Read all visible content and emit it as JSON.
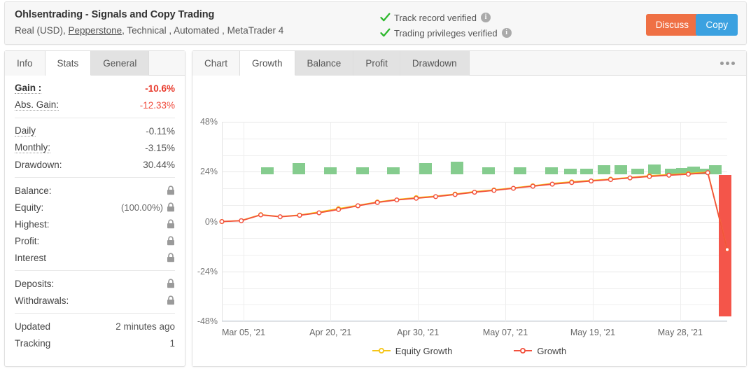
{
  "header": {
    "title": "Ohlsentrading - Signals and Copy Trading",
    "subtitle_parts": {
      "prefix": "Real (USD),",
      "broker": "Pepperstone",
      "suffix": ", Technical , Automated , MetaTrader 4"
    },
    "verifications": [
      {
        "label": "Track record verified",
        "icon": "check-icon",
        "info": "i"
      },
      {
        "label": "Trading privileges verified",
        "icon": "check-icon",
        "info": "i"
      }
    ],
    "buttons": {
      "discuss": "Discuss",
      "copy": "Copy"
    },
    "colors": {
      "discuss_bg": "#ef7044",
      "copy_bg": "#3ba1e0",
      "check_green": "#2eb82e",
      "info_grey": "#aaaaaa"
    }
  },
  "sidebar": {
    "tabs": [
      {
        "label": "Info",
        "active": false
      },
      {
        "label": "Stats",
        "active": true
      },
      {
        "label": "General",
        "active": false
      }
    ],
    "groups": [
      {
        "rows": [
          {
            "label": "Gain :",
            "value": "-10.6%",
            "style": "neg-strong",
            "bold": true,
            "dotted": true
          },
          {
            "label": "Abs. Gain:",
            "value": "-12.33%",
            "style": "neg",
            "dotted": true
          }
        ]
      },
      {
        "rows": [
          {
            "label": "Daily",
            "value": "-0.11%",
            "dotted": true
          },
          {
            "label": "Monthly:",
            "value": "-3.15%",
            "dotted": true
          },
          {
            "label": "Drawdown:",
            "value": "30.44%"
          }
        ]
      },
      {
        "rows": [
          {
            "label": "Balance:",
            "value": "",
            "lock": true
          },
          {
            "label": "Equity:",
            "value": "(100.00%)",
            "lock": true
          },
          {
            "label": "Highest:",
            "value": "",
            "lock": true
          },
          {
            "label": "Profit:",
            "value": "",
            "lock": true
          },
          {
            "label": "Interest",
            "value": "",
            "lock": true
          }
        ]
      },
      {
        "rows": [
          {
            "label": "Deposits:",
            "value": "",
            "lock": true
          },
          {
            "label": "Withdrawals:",
            "value": "",
            "lock": true
          }
        ]
      },
      {
        "rows": [
          {
            "label": "Updated",
            "value": "2 minutes ago"
          },
          {
            "label": "Tracking",
            "value": "1"
          }
        ]
      }
    ]
  },
  "chart_panel": {
    "tabs": [
      {
        "label": "Chart",
        "active": false,
        "plain": true
      },
      {
        "label": "Growth",
        "active": true
      },
      {
        "label": "Balance",
        "active": false
      },
      {
        "label": "Profit",
        "active": false
      },
      {
        "label": "Drawdown",
        "active": false
      }
    ],
    "menu_icon": "dots-menu-icon"
  },
  "chart_data": {
    "type": "line",
    "title": "Growth",
    "xlabel": "",
    "ylabel": "",
    "ylim": [
      -48,
      48
    ],
    "yticks": [
      48,
      24,
      0,
      -24,
      -48
    ],
    "ytick_labels": [
      "48%",
      "24%",
      "0%",
      "-24%",
      "-48%"
    ],
    "grid": true,
    "legend_position": "bottom",
    "xtick_labels": [
      "Mar 05, '21",
      "Apr 20, '21",
      "Apr 30, '21",
      "May 07, '21",
      "May 19, '21",
      "May 28, '21"
    ],
    "xtick_positions_pct": [
      4.3,
      21.5,
      38.8,
      56.1,
      73.4,
      90.7
    ],
    "series": [
      {
        "name": "Equity Growth",
        "color": "#f5c518",
        "marker": "circle-open",
        "values": [
          0.0,
          0.5,
          3.3,
          2.4,
          3.1,
          4.6,
          6.2,
          7.8,
          9.4,
          10.6,
          11.5,
          12.2,
          13.2,
          14.4,
          15.2,
          16.2,
          17.2,
          18.3,
          19.1,
          19.8,
          20.4,
          21.2,
          22.0,
          22.6,
          23.1,
          23.8,
          -13.5
        ]
      },
      {
        "name": "Growth",
        "color": "#f2513d",
        "marker": "circle-open",
        "values": [
          0.0,
          0.4,
          3.2,
          2.3,
          3.0,
          4.2,
          5.8,
          7.6,
          9.2,
          10.4,
          11.2,
          12.0,
          13.0,
          14.1,
          15.0,
          16.0,
          17.0,
          18.0,
          18.8,
          19.5,
          20.2,
          21.0,
          21.7,
          22.3,
          22.8,
          23.5,
          -13.5
        ]
      }
    ],
    "bars": {
      "name": "Monthly bars",
      "positive_color": "#85cc8e",
      "negative_color": "#f4554a",
      "baseline": 24,
      "items": [
        {
          "x_pct": 9.0,
          "top": 26.0,
          "bottom": 22.8,
          "sign": "pos"
        },
        {
          "x_pct": 15.2,
          "top": 28.2,
          "bottom": 22.8,
          "sign": "pos"
        },
        {
          "x_pct": 21.5,
          "top": 26.0,
          "bottom": 22.8,
          "sign": "pos"
        },
        {
          "x_pct": 27.8,
          "top": 26.2,
          "bottom": 22.8,
          "sign": "pos"
        },
        {
          "x_pct": 34.0,
          "top": 26.2,
          "bottom": 22.8,
          "sign": "pos"
        },
        {
          "x_pct": 40.3,
          "top": 28.2,
          "bottom": 22.8,
          "sign": "pos"
        },
        {
          "x_pct": 46.5,
          "top": 28.8,
          "bottom": 22.8,
          "sign": "pos"
        },
        {
          "x_pct": 52.8,
          "top": 26.0,
          "bottom": 22.8,
          "sign": "pos"
        },
        {
          "x_pct": 59.0,
          "top": 26.0,
          "bottom": 22.8,
          "sign": "pos"
        },
        {
          "x_pct": 65.3,
          "top": 26.0,
          "bottom": 22.8,
          "sign": "pos"
        },
        {
          "x_pct": 69.0,
          "top": 25.4,
          "bottom": 22.8,
          "sign": "pos"
        },
        {
          "x_pct": 72.2,
          "top": 25.4,
          "bottom": 22.8,
          "sign": "pos"
        },
        {
          "x_pct": 75.6,
          "top": 27.0,
          "bottom": 22.8,
          "sign": "pos"
        },
        {
          "x_pct": 79.0,
          "top": 27.2,
          "bottom": 22.8,
          "sign": "pos"
        },
        {
          "x_pct": 82.3,
          "top": 25.6,
          "bottom": 22.8,
          "sign": "pos"
        },
        {
          "x_pct": 85.6,
          "top": 27.4,
          "bottom": 22.8,
          "sign": "pos"
        },
        {
          "x_pct": 88.9,
          "top": 25.6,
          "bottom": 22.8,
          "sign": "pos"
        },
        {
          "x_pct": 91.2,
          "top": 25.8,
          "bottom": 22.8,
          "sign": "pos"
        },
        {
          "x_pct": 93.4,
          "top": 26.4,
          "bottom": 22.8,
          "sign": "pos"
        },
        {
          "x_pct": 95.5,
          "top": 25.4,
          "bottom": 22.8,
          "sign": "pos"
        },
        {
          "x_pct": 97.6,
          "top": 27.2,
          "bottom": 22.8,
          "sign": "pos"
        },
        {
          "x_pct": 99.6,
          "top": 22.4,
          "bottom": -45.6,
          "sign": "neg"
        }
      ]
    },
    "legend": [
      {
        "label": "Equity Growth",
        "color": "#f5c518"
      },
      {
        "label": "Growth",
        "color": "#f2513d"
      }
    ]
  }
}
